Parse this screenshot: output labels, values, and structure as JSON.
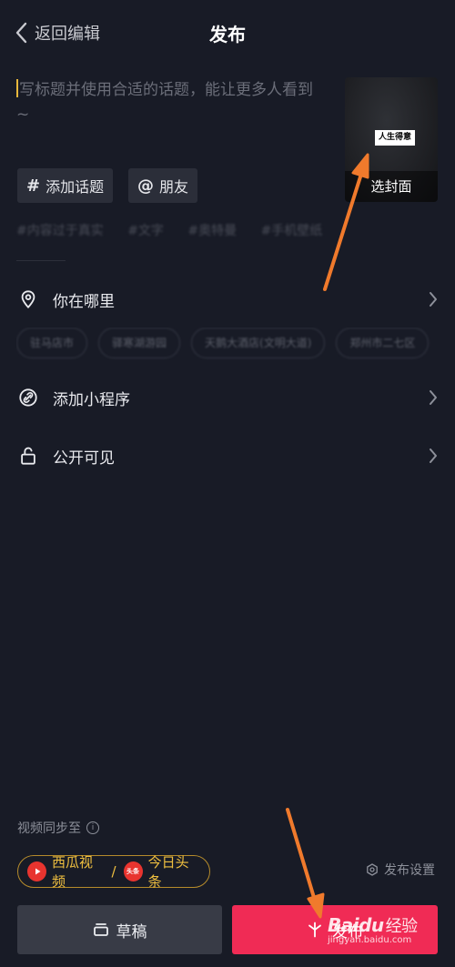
{
  "header": {
    "back_label": "返回编辑",
    "title": "发布"
  },
  "caption": {
    "placeholder": "写标题并使用合适的话题，能让更多人看到 ~"
  },
  "cover": {
    "badge_text": "人生得意",
    "select_label": "选封面"
  },
  "chips": {
    "topic_label": "添加话题",
    "topic_icon": "hash-icon",
    "friend_label": "朋友",
    "friend_icon": "at-icon"
  },
  "hashtags": [
    "#内容过于真实",
    "#文字",
    "#奥特曼",
    "#手机壁纸"
  ],
  "location": {
    "label": "你在哪里",
    "icon": "location-pin-icon",
    "places": [
      "驻马店市",
      "驿寒湖游园",
      "天鹅大酒店(文明大道)",
      "郑州市二七区"
    ]
  },
  "mini_program": {
    "label": "添加小程序",
    "icon": "link-icon"
  },
  "visibility": {
    "label": "公开可见",
    "icon": "unlock-icon"
  },
  "sync": {
    "label": "视频同步至",
    "xigua_label": "西瓜视频",
    "separator": "/",
    "toutiao_badge": "头条",
    "toutiao_label": "今日头条",
    "settings_label": "发布设置"
  },
  "buttons": {
    "draft_label": "草稿",
    "publish_label": "发布"
  },
  "watermark": {
    "logo": "Baidu",
    "logo_suffix": "经验",
    "url": "jingyan.baidu.com"
  },
  "colors": {
    "background": "#181b26",
    "publish": "#f02b55",
    "accent_gold": "#f0c040",
    "arrow": "#f07a2c"
  }
}
